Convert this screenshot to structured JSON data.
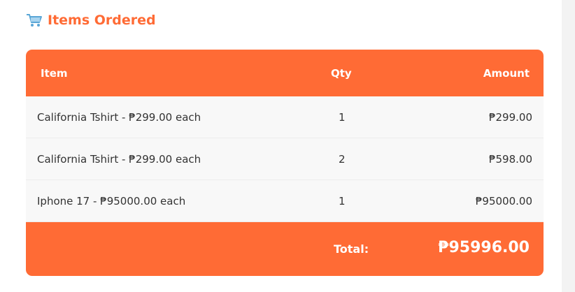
{
  "section": {
    "title": "Items Ordered",
    "icon": "shopping-cart-icon"
  },
  "table": {
    "headers": {
      "item": "Item",
      "qty": "Qty",
      "amount": "Amount"
    },
    "rows": [
      {
        "item": "California Tshirt - ₱299.00 each",
        "qty": "1",
        "amount": "₱299.00"
      },
      {
        "item": "California Tshirt - ₱299.00 each",
        "qty": "2",
        "amount": "₱598.00"
      },
      {
        "item": "Iphone 17 - ₱95000.00 each",
        "qty": "1",
        "amount": "₱95000.00"
      }
    ],
    "total_label": "Total:",
    "total_value": "₱95996.00"
  },
  "colors": {
    "accent": "#ff6b35",
    "row_bg": "#f8f8f8",
    "text": "#333333",
    "page_bg": "#f3f3f3"
  }
}
